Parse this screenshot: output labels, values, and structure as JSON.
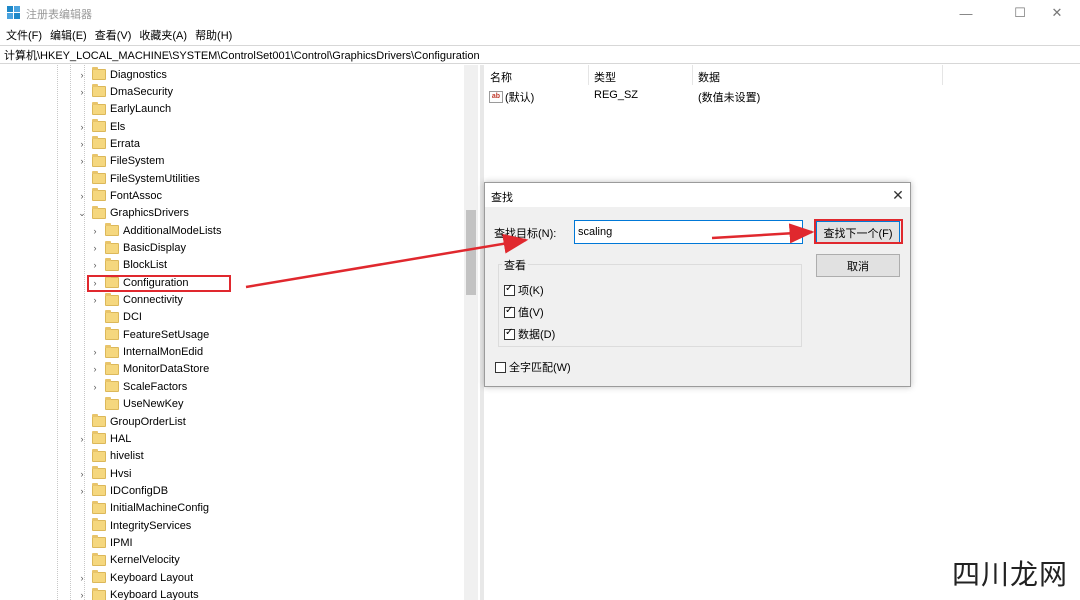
{
  "window": {
    "title": "注册表编辑器",
    "minimize_glyph": "—",
    "maximize_glyph": "☐",
    "close_glyph": "✕",
    "icon": "registry-editor-icon"
  },
  "menu": [
    "文件(F)",
    "编辑(E)",
    "查看(V)",
    "收藏夹(A)",
    "帮助(H)"
  ],
  "address": "计算机\\HKEY_LOCAL_MACHINE\\SYSTEM\\ControlSet001\\Control\\GraphicsDrivers\\Configuration",
  "tree": {
    "items": [
      {
        "label": "Diagnostics",
        "level": 1,
        "expandable": true
      },
      {
        "label": "DmaSecurity",
        "level": 1,
        "expandable": true
      },
      {
        "label": "EarlyLaunch",
        "level": 1,
        "expandable": false
      },
      {
        "label": "Els",
        "level": 1,
        "expandable": true
      },
      {
        "label": "Errata",
        "level": 1,
        "expandable": true
      },
      {
        "label": "FileSystem",
        "level": 1,
        "expandable": true
      },
      {
        "label": "FileSystemUtilities",
        "level": 1,
        "expandable": false
      },
      {
        "label": "FontAssoc",
        "level": 1,
        "expandable": true
      },
      {
        "label": "GraphicsDrivers",
        "level": 1,
        "expandable": true,
        "expanded": true
      },
      {
        "label": "AdditionalModeLists",
        "level": 2,
        "expandable": true
      },
      {
        "label": "BasicDisplay",
        "level": 2,
        "expandable": true
      },
      {
        "label": "BlockList",
        "level": 2,
        "expandable": true
      },
      {
        "label": "Configuration",
        "level": 2,
        "expandable": true,
        "selected": true
      },
      {
        "label": "Connectivity",
        "level": 2,
        "expandable": true
      },
      {
        "label": "DCI",
        "level": 2,
        "expandable": false
      },
      {
        "label": "FeatureSetUsage",
        "level": 2,
        "expandable": false
      },
      {
        "label": "InternalMonEdid",
        "level": 2,
        "expandable": true
      },
      {
        "label": "MonitorDataStore",
        "level": 2,
        "expandable": true
      },
      {
        "label": "ScaleFactors",
        "level": 2,
        "expandable": true
      },
      {
        "label": "UseNewKey",
        "level": 2,
        "expandable": false
      },
      {
        "label": "GroupOrderList",
        "level": 1,
        "expandable": false
      },
      {
        "label": "HAL",
        "level": 1,
        "expandable": true
      },
      {
        "label": "hivelist",
        "level": 1,
        "expandable": false
      },
      {
        "label": "Hvsi",
        "level": 1,
        "expandable": true
      },
      {
        "label": "IDConfigDB",
        "level": 1,
        "expandable": true
      },
      {
        "label": "InitialMachineConfig",
        "level": 1,
        "expandable": false
      },
      {
        "label": "IntegrityServices",
        "level": 1,
        "expandable": false
      },
      {
        "label": "IPMI",
        "level": 1,
        "expandable": false
      },
      {
        "label": "KernelVelocity",
        "level": 1,
        "expandable": false
      },
      {
        "label": "Keyboard Layout",
        "level": 1,
        "expandable": true
      },
      {
        "label": "Keyboard Layouts",
        "level": 1,
        "expandable": true
      }
    ]
  },
  "values": {
    "columns": {
      "name": "名称",
      "type": "类型",
      "data": "数据"
    },
    "rows": [
      {
        "icon": "string-value-icon",
        "icon_text": "ab",
        "name": "(默认)",
        "type": "REG_SZ",
        "data": "(数值未设置)"
      }
    ]
  },
  "find_dialog": {
    "title": "查找",
    "close_glyph": "✕",
    "target_label": "查找目标(N):",
    "target_value": "scaling",
    "find_next_label": "查找下一个(F)",
    "cancel_label": "取消",
    "look_at_label": "查看",
    "options": [
      {
        "label": "项(K)",
        "checked": true
      },
      {
        "label": "值(V)",
        "checked": true
      },
      {
        "label": "数据(D)",
        "checked": true
      }
    ],
    "match_whole": {
      "label": "全字匹配(W)",
      "checked": false
    }
  },
  "annotations": {
    "color": "#e0282e"
  },
  "watermark": "四川龙网"
}
